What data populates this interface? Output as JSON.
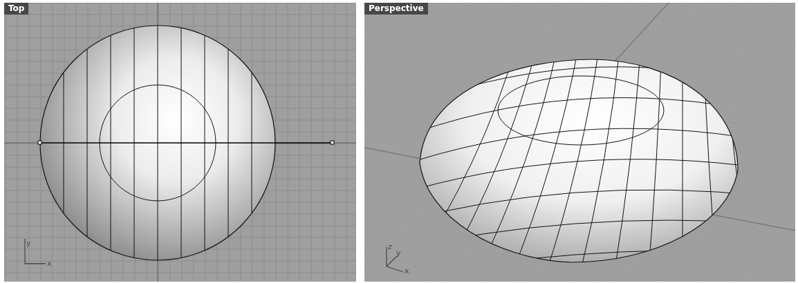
{
  "viewports": [
    {
      "title": "Top",
      "kind": "top",
      "axes": [
        {
          "label": "y"
        },
        {
          "label": "x"
        }
      ]
    },
    {
      "title": "Perspective",
      "kind": "perspective",
      "axes": [
        {
          "label": "z"
        },
        {
          "label": "y"
        },
        {
          "label": "x"
        }
      ]
    }
  ]
}
